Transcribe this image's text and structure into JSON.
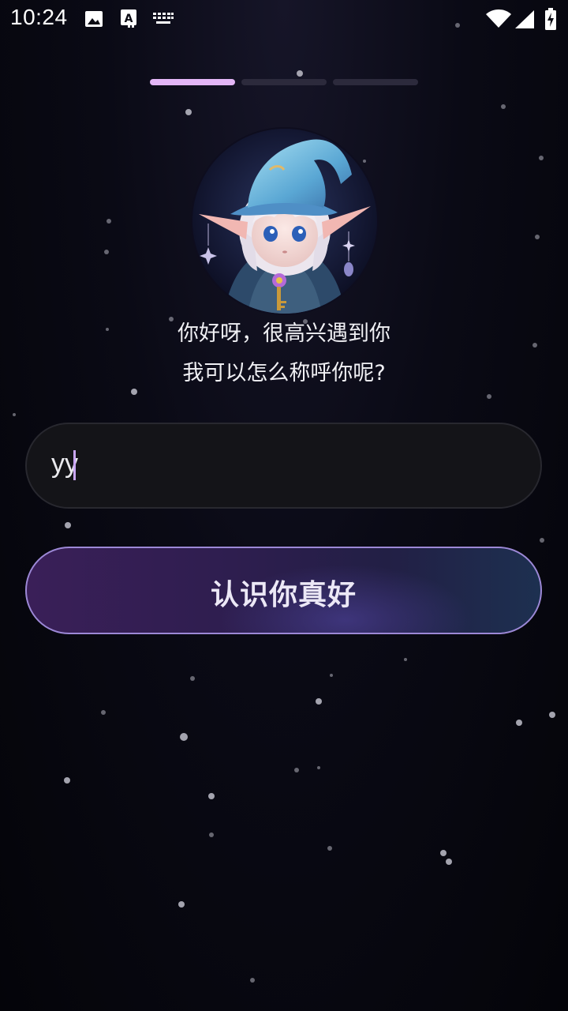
{
  "status_bar": {
    "time": "10:24",
    "icons": [
      "image-icon",
      "text-recognition-icon",
      "keyboard-icon",
      "wifi-icon",
      "signal-icon",
      "battery-charging-icon"
    ]
  },
  "onboarding": {
    "step_current": 1,
    "step_total": 3,
    "colors": {
      "progress_active": "#e3b6f6",
      "progress_inactive": "#2c2a3c"
    },
    "avatar": "wizard-elf-avatar",
    "greeting_line1": "你好呀，很高兴遇到你",
    "greeting_line2": "我可以怎么称呼你呢?",
    "name_input": {
      "value": "yy"
    },
    "confirm_button": {
      "label": "认识你真好"
    }
  }
}
